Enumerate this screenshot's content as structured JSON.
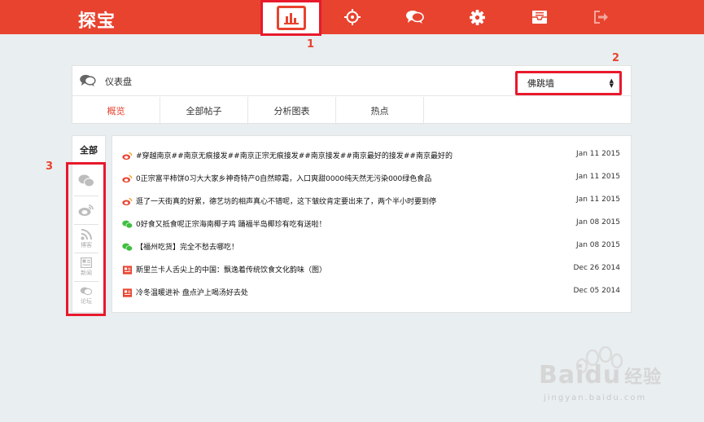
{
  "app": {
    "title": "探宝"
  },
  "nav": {
    "items": [
      {
        "name": "dashboard",
        "icon": "bar-chart-icon",
        "active": true
      },
      {
        "name": "target",
        "icon": "crosshair-icon"
      },
      {
        "name": "messages",
        "icon": "chat-bubbles-icon"
      },
      {
        "name": "settings",
        "icon": "gear-icon"
      },
      {
        "name": "inbox",
        "icon": "inbox-icon"
      },
      {
        "name": "logout",
        "icon": "sign-out-icon"
      }
    ]
  },
  "annotations": [
    "1",
    "2",
    "3"
  ],
  "dashboard": {
    "title": "仪表盘",
    "select_value": "佛跳墙",
    "tabs": [
      "概览",
      "全部帖子",
      "分析图表",
      "热点"
    ]
  },
  "sidebar": {
    "all_label": "全部",
    "items": [
      {
        "icon": "wechat-icon",
        "label": ""
      },
      {
        "icon": "weibo-icon",
        "label": ""
      },
      {
        "icon": "rss-icon",
        "label": "博客"
      },
      {
        "icon": "newspaper-icon",
        "label": "新闻"
      },
      {
        "icon": "forum-icon",
        "label": "论坛"
      }
    ]
  },
  "feed": [
    {
      "source": "weibo",
      "text": "#穿越南京##南京无痕接发##南京正宗无痕接发##南京接发##南京最好的接发##南京最好的",
      "date": "Jan 11 2015"
    },
    {
      "source": "weibo",
      "text": "0正宗富平柿饼0习大大家乡神奇特产0自然晾霜，入口爽甜0000纯天然无污染000绿色食品",
      "date": "Jan 11 2015"
    },
    {
      "source": "weibo",
      "text": "逛了一天街真的好累，德艺坊的相声真心不错呢，这下皱纹肯定要出来了，两个半小时要到停",
      "date": "Jan 11 2015"
    },
    {
      "source": "wechat",
      "text": "0好食又抵食呢正宗海南椰子鸡 踊福半岛椰珍有吃有送啦！",
      "date": "Jan 08 2015"
    },
    {
      "source": "wechat",
      "text": "【福州吃货】完全不愁去哪吃！",
      "date": "Jan 08 2015"
    },
    {
      "source": "news",
      "text": "斯里兰卡人舌尖上的中国：飘逸着传统饮食文化韵味（图）",
      "date": "Dec 26 2014"
    },
    {
      "source": "news",
      "text": "冷冬温暖进补 盘点沪上喝汤好去处",
      "date": "Dec 05 2014"
    }
  ],
  "watermark": {
    "brand": "Baidu",
    "text": "经验",
    "url": "jingyan.baidu.com"
  },
  "colors": {
    "brand_red": "#e8432f",
    "highlight_red": "#e8192c",
    "weibo": "#e8432f",
    "wechat": "#3fbf3f",
    "news": "#e8432f",
    "background": "#e9eef0"
  }
}
